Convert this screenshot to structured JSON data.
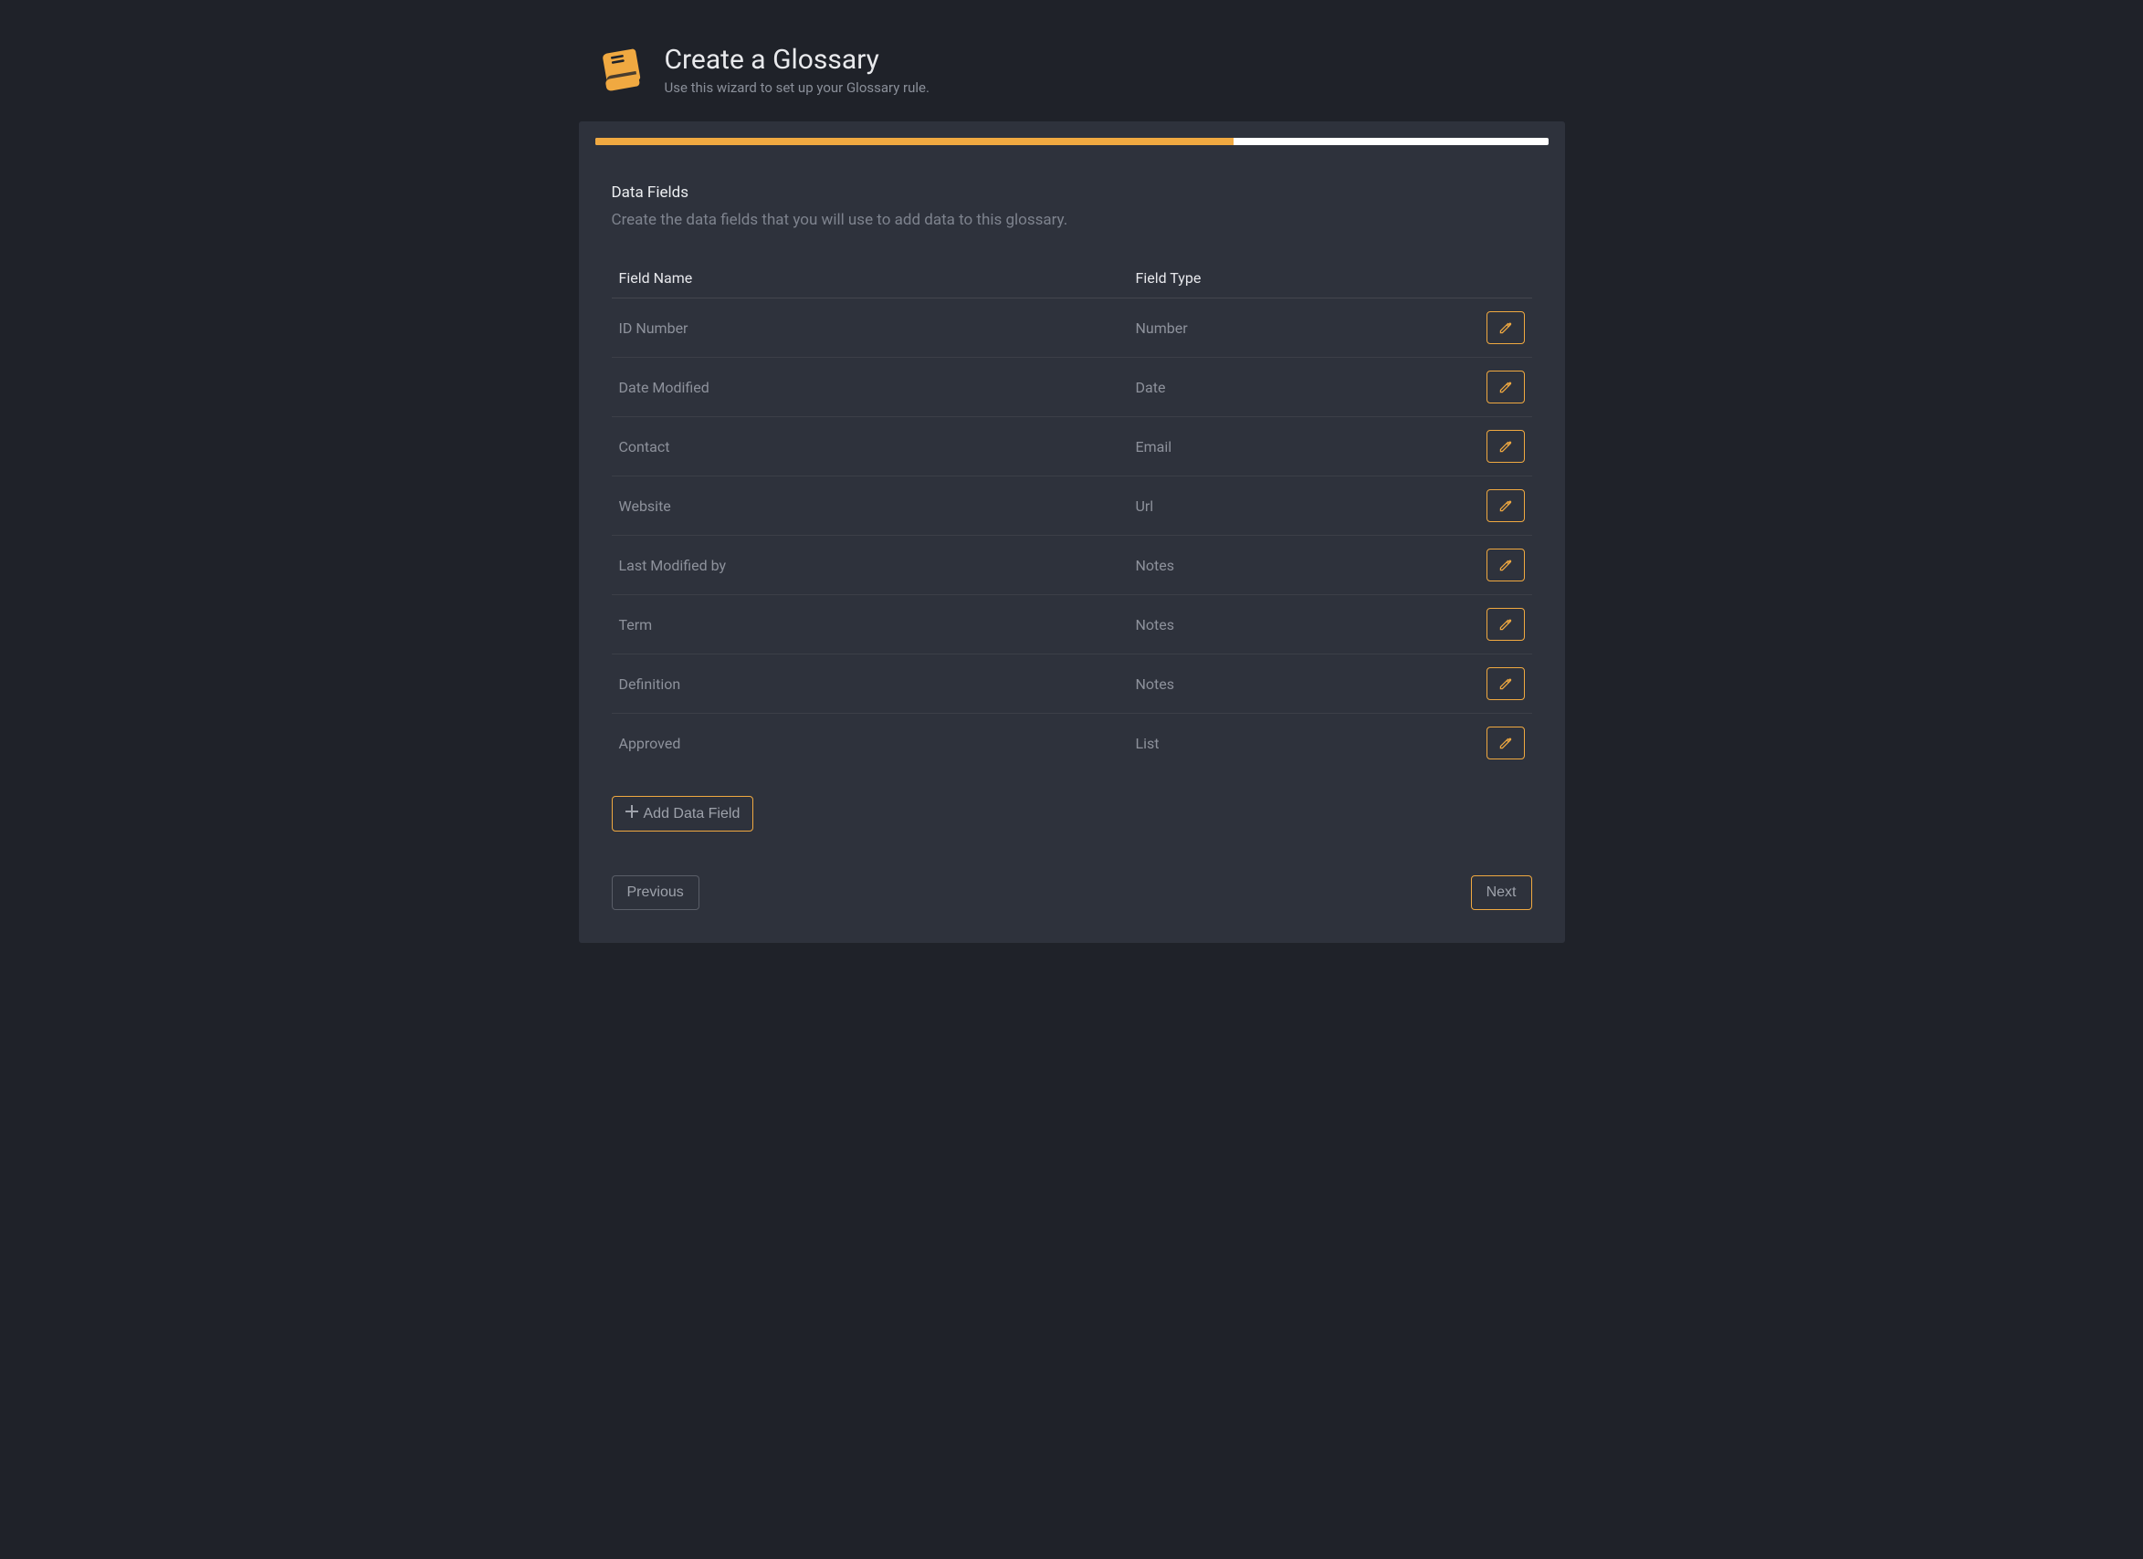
{
  "header": {
    "title": "Create a Glossary",
    "subtitle": "Use this wizard to set up your Glossary rule."
  },
  "progress": {
    "percent": 67
  },
  "section": {
    "title": "Data Fields",
    "subtitle": "Create the data fields that you will use to add data to this glossary."
  },
  "table": {
    "col_name": "Field Name",
    "col_type": "Field Type",
    "rows": [
      {
        "name": "ID Number",
        "type": "Number"
      },
      {
        "name": "Date Modified",
        "type": "Date"
      },
      {
        "name": "Contact",
        "type": "Email"
      },
      {
        "name": "Website",
        "type": "Url"
      },
      {
        "name": "Last Modified by",
        "type": "Notes"
      },
      {
        "name": "Term",
        "type": "Notes"
      },
      {
        "name": "Definition",
        "type": "Notes"
      },
      {
        "name": "Approved",
        "type": "List"
      }
    ]
  },
  "buttons": {
    "add_field": "Add Data Field",
    "previous": "Previous",
    "next": "Next"
  },
  "colors": {
    "accent": "#f0a941",
    "panel": "#2e323c",
    "page_bg": "#1f2229"
  }
}
